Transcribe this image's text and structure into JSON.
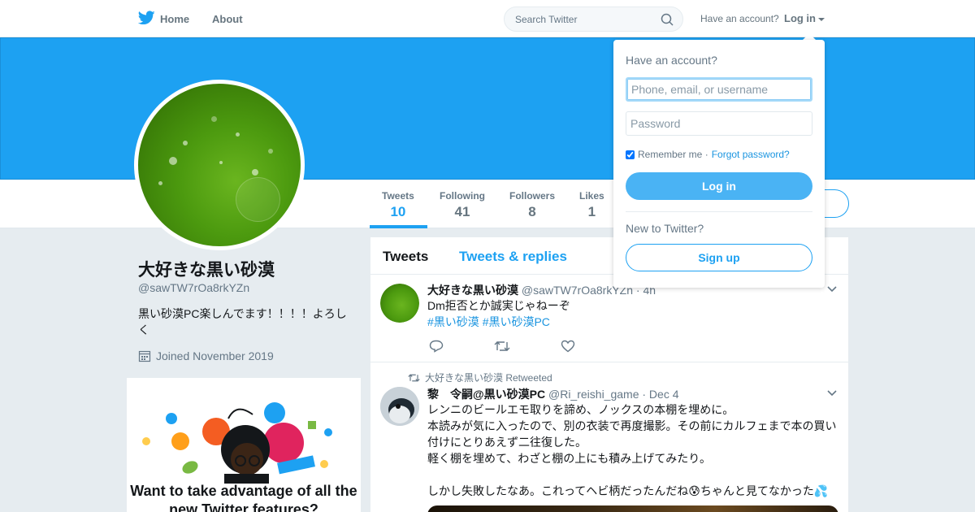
{
  "nav": {
    "home_label": "Home",
    "about_label": "About",
    "search_placeholder": "Search Twitter",
    "have_account": "Have an account?",
    "login_label": "Log in"
  },
  "colors": {
    "brand_blue": "#1da1f2",
    "banner": "#1da1f2",
    "link": "#1b95e0"
  },
  "profile": {
    "name": "大好きな黒い砂漠",
    "handle": "@sawTW7rOa8rkYZn",
    "bio": "黒い砂漠PC楽しんでます！！！！よろしく",
    "joined": "Joined November 2019",
    "stats": [
      {
        "label": "Tweets",
        "value": "10"
      },
      {
        "label": "Following",
        "value": "41"
      },
      {
        "label": "Followers",
        "value": "8"
      },
      {
        "label": "Likes",
        "value": "1"
      }
    ]
  },
  "promo": {
    "title": "Want to take advantage of all the new Twitter features?"
  },
  "timeline": {
    "tabs": [
      "Tweets",
      "Tweets & replies"
    ],
    "tweets": [
      {
        "fullname": "大好きな黒い砂漠",
        "username": "@sawTW7rOa8rkYZn",
        "time": "· 4h",
        "text": "Dm拒否とか誠実じゃねーぞ",
        "tags": [
          "#黒い砂漠",
          "#黒い砂漠PC"
        ]
      },
      {
        "retweet_context": "大好きな黒い砂漠 Retweeted",
        "fullname": "黎　令嗣@黒い砂漠PC",
        "username": "@Ri_reishi_game",
        "time": "· Dec 4",
        "lines": [
          "レンニのビールエモ取りを諦め、ノックスの本棚を埋めに。",
          "本読みが気に入ったので、別の衣装で再度撮影。その前にカルフェまで本の買い",
          "付けにとりあえず二往復した。",
          "軽く棚を埋めて、わざと棚の上にも積み上げてみたり。",
          "",
          "しかし失敗したなあ。これってヘビ柄だったんだね😰ちゃんと見てなかった💦"
        ]
      }
    ]
  },
  "login_dropdown": {
    "title": "Have an account?",
    "username_placeholder": "Phone, email, or username",
    "password_placeholder": "Password",
    "remember_me": "Remember me ·",
    "forgot_password": "Forgot password?",
    "login_button": "Log in",
    "new_to_twitter": "New to Twitter?",
    "signup_button": "Sign up"
  }
}
